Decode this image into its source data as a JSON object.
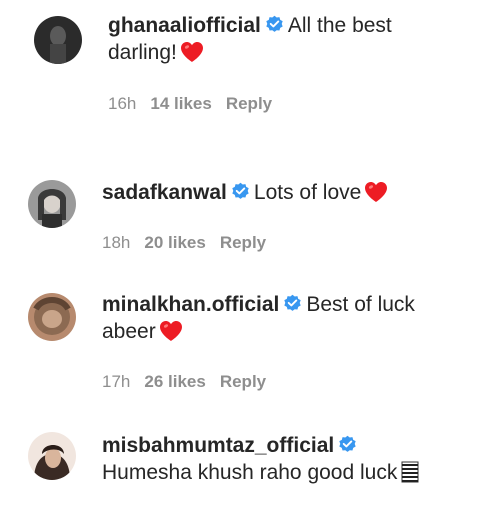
{
  "comments": [
    {
      "username": "ghanaaliofficial",
      "text_line1": "All the best",
      "text_line2": "darling!",
      "emoji": "heart-icon",
      "time": "16h",
      "likes": "14 likes",
      "reply": "Reply"
    },
    {
      "username": "sadafkanwal",
      "text_line1": "Lots of love",
      "emoji": "heart-icon",
      "time": "18h",
      "likes": "20 likes",
      "reply": "Reply"
    },
    {
      "username": "minalkhan.official",
      "text_line1": "Best of luck",
      "text_line2": "abeer",
      "emoji": "heart-icon",
      "time": "17h",
      "likes": "26 likes",
      "reply": "Reply"
    },
    {
      "username": "misbahmumtaz_official",
      "text_line2": "Humesha khush raho good luck",
      "emoji": "flag-icon"
    }
  ],
  "colors": {
    "verified": "#3897f0",
    "heart": "#ed1c24",
    "meta_text": "#8e8e8e",
    "text": "#262626"
  }
}
